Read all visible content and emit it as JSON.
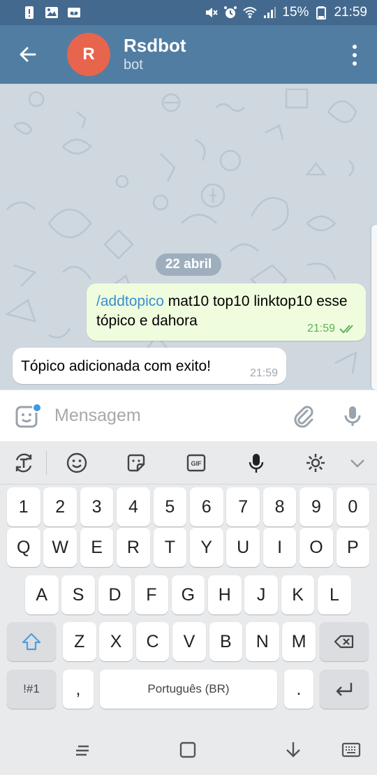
{
  "status_bar": {
    "battery_percent": "15%",
    "time": "21:59",
    "left_icons": [
      "alert-icon",
      "gallery-icon",
      "voicemail-icon"
    ],
    "right_icons": [
      "mute-icon",
      "alarm-icon",
      "wifi-icon",
      "signal-icon",
      "battery-icon"
    ]
  },
  "header": {
    "avatar_letter": "R",
    "avatar_color": "#e8654d",
    "title": "Rsdbot",
    "subtitle": "bot",
    "bar_color": "#517da2"
  },
  "chat": {
    "date_label": "22 abril",
    "messages": [
      {
        "direction": "outgoing",
        "command": "/addtopico",
        "text_after_command": " mat10 top10 linktop10 esse tópico e dahora",
        "time": "21:59",
        "status": "read"
      },
      {
        "direction": "incoming",
        "text": "Tópico adicionada com exito!",
        "time": "21:59"
      }
    ]
  },
  "input": {
    "placeholder": "Mensagem"
  },
  "keyboard": {
    "toolbar_icons": [
      "translate-icon",
      "emoji-icon",
      "sticker-icon",
      "gif-icon",
      "voice-icon",
      "settings-icon",
      "collapse-icon"
    ],
    "number_row": [
      "1",
      "2",
      "3",
      "4",
      "5",
      "6",
      "7",
      "8",
      "9",
      "0"
    ],
    "row1": [
      "Q",
      "W",
      "E",
      "R",
      "T",
      "Y",
      "U",
      "I",
      "O",
      "P"
    ],
    "row2": [
      "A",
      "S",
      "D",
      "F",
      "G",
      "H",
      "J",
      "K",
      "L"
    ],
    "row3": [
      "Z",
      "X",
      "C",
      "V",
      "B",
      "N",
      "M"
    ],
    "symbols_key": "!#1",
    "comma_key": ",",
    "space_label": "Português (BR)",
    "period_key": "."
  },
  "nav_bar": {
    "icons": [
      "recents-icon",
      "home-icon",
      "back-nav-icon",
      "keyboard-switch-icon"
    ]
  }
}
